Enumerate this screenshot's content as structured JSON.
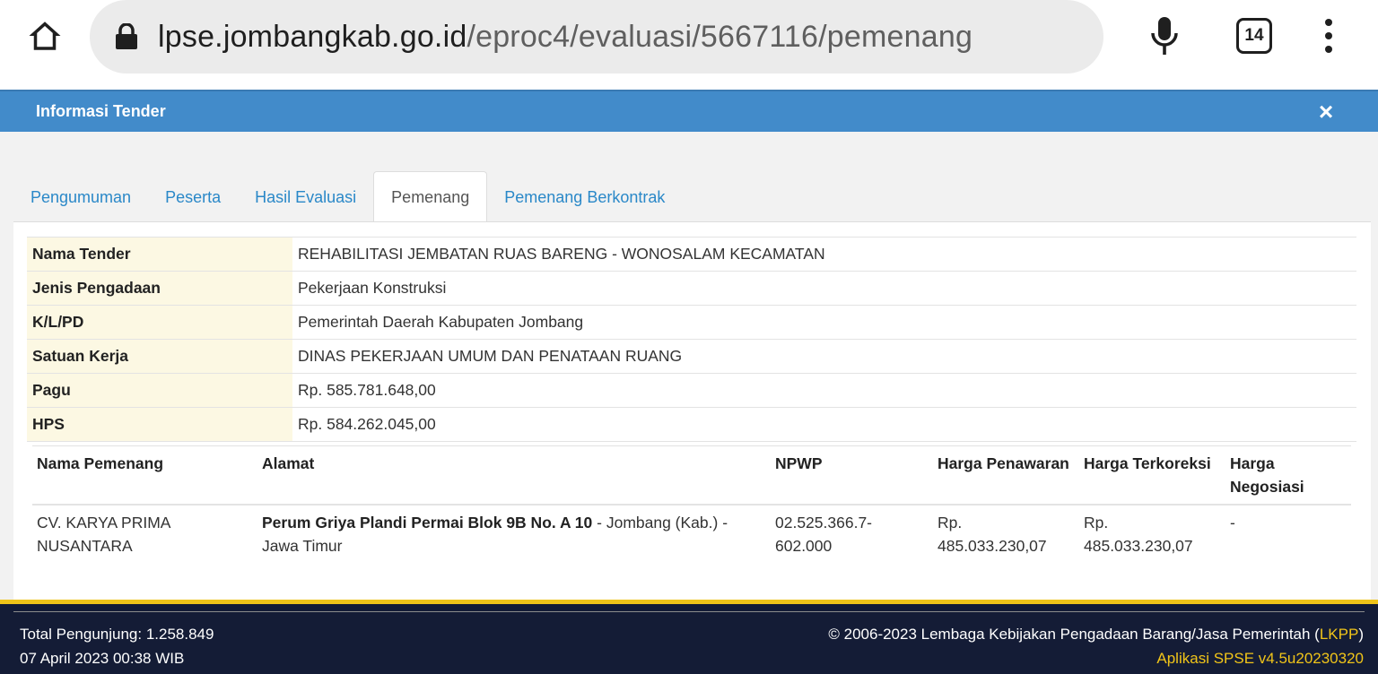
{
  "browser": {
    "url_domain": "lpse.jombangkab.go.id",
    "url_path": "/eproc4/evaluasi/5667116/pemenang",
    "tab_count": "14"
  },
  "modal": {
    "title": "Informasi Tender",
    "close_label": "×"
  },
  "tabs": [
    {
      "label": "Pengumuman",
      "active": false
    },
    {
      "label": "Peserta",
      "active": false
    },
    {
      "label": "Hasil Evaluasi",
      "active": false
    },
    {
      "label": "Pemenang",
      "active": true
    },
    {
      "label": "Pemenang Berkontrak",
      "active": false
    }
  ],
  "info": [
    {
      "label": "Nama Tender",
      "value": "REHABILITASI JEMBATAN RUAS BARENG - WONOSALAM KECAMATAN"
    },
    {
      "label": "Jenis Pengadaan",
      "value": "Pekerjaan Konstruksi"
    },
    {
      "label": "K/L/PD",
      "value": "Pemerintah Daerah Kabupaten Jombang"
    },
    {
      "label": "Satuan Kerja",
      "value": "DINAS PEKERJAAN UMUM DAN PENATAAN RUANG"
    },
    {
      "label": "Pagu",
      "value": "Rp. 585.781.648,00"
    },
    {
      "label": "HPS",
      "value": "Rp. 584.262.045,00"
    }
  ],
  "winner_table": {
    "headers": [
      "Nama Pemenang",
      "Alamat",
      "NPWP",
      "Harga Penawaran",
      "Harga Terkoreksi",
      "Harga Negosiasi"
    ],
    "rows": [
      {
        "nama": "CV. KARYA PRIMA NUSANTARA",
        "alamat_bold": "Perum Griya Plandi Permai Blok 9B No. A 10",
        "alamat_rest": " - Jombang (Kab.) - Jawa Timur",
        "npwp": "02.525.366.7-602.000",
        "harga_penawaran": "Rp. 485.033.230,07",
        "harga_terkoreksi": "Rp. 485.033.230,07",
        "harga_negosiasi": "-"
      }
    ]
  },
  "footer": {
    "visitors": "Total Pengunjung: 1.258.849",
    "datetime": "07 April 2023 00:38 WIB",
    "copyright_prefix": "© 2006-2023 Lembaga Kebijakan Pengadaan Barang/Jasa Pemerintah (",
    "copyright_link": "LKPP",
    "copyright_suffix": ")",
    "app_version": "Aplikasi SPSE v4.5u20230320"
  },
  "colors": {
    "header_blue": "#428bca",
    "tab_link": "#2a88c8",
    "label_bg": "#fcf8e3",
    "footer_bg": "#141c36",
    "footer_accent": "#f0c419"
  },
  "icons": {
    "home": "home-icon",
    "lock": "lock-icon",
    "mic": "microphone-icon",
    "tabs": "tab-switcher-icon",
    "menu": "more-vertical-icon",
    "close": "close-icon"
  }
}
